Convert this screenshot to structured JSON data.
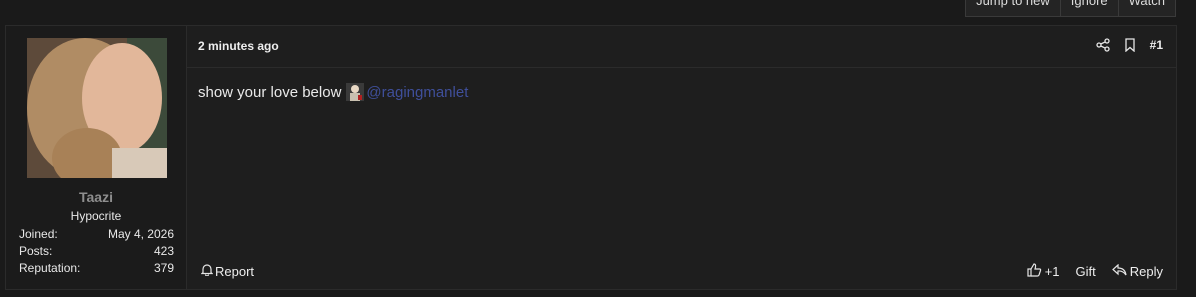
{
  "thread_actions": [
    "Jump to new",
    "Ignore",
    "Watch"
  ],
  "user": {
    "name": "Taazi",
    "title": "Hypocrite",
    "stats": [
      {
        "label": "Joined:",
        "value": "May 4, 2026"
      },
      {
        "label": "Posts:",
        "value": "423"
      },
      {
        "label": "Reputation:",
        "value": "379"
      }
    ]
  },
  "post": {
    "date": "2 minutes ago",
    "number": "#1",
    "body_text": "show your love below",
    "mention": "@ragingmanlet"
  },
  "footer": {
    "report": "Report",
    "like": "+1",
    "gift": "Gift",
    "reply": "Reply"
  },
  "icons": {
    "header": [
      "share-icon",
      "bookmark-icon"
    ],
    "footer": [
      "bell-icon",
      "thumbs-up-icon",
      "reply-arrow-icon"
    ]
  }
}
